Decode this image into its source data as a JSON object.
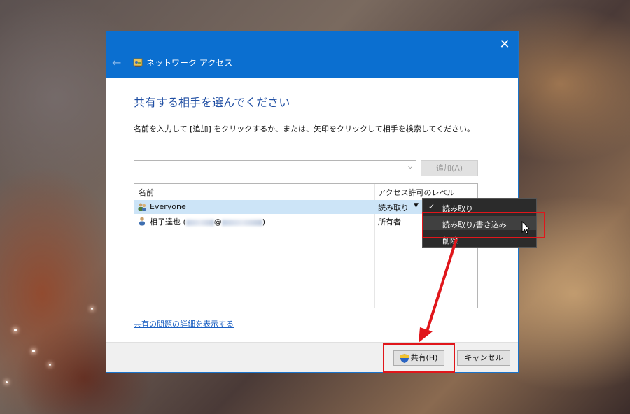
{
  "window": {
    "title": "ネットワーク アクセス",
    "close_glyph": "✕",
    "back_glyph": "←"
  },
  "heading": "共有する相手を選んでください",
  "instruction": "名前を入力して [追加] をクリックするか、または、矢印をクリックして相手を検索してください。",
  "input": {
    "value": "",
    "dropdown_glyph": "⌵"
  },
  "add_button": "追加(A)",
  "list": {
    "columns": [
      "名前",
      "アクセス許可のレベル"
    ],
    "rows": [
      {
        "name": "Everyone",
        "level": "読み取り",
        "arrow": "▼",
        "selected": true,
        "icon": "group-icon"
      },
      {
        "name_prefix": "相子達也 (",
        "name_at": "@",
        "name_suffix": ")",
        "level": "所有者",
        "selected": false,
        "icon": "user-icon"
      }
    ]
  },
  "link": "共有の問題の詳細を表示する",
  "footer": {
    "share_button": "共有(H)",
    "cancel_button": "キャンセル"
  },
  "context_menu": {
    "items": [
      {
        "label": "読み取り",
        "checked": true,
        "check_glyph": "✓"
      },
      {
        "label": "読み取り/書き込み",
        "checked": false
      },
      {
        "label": "削除",
        "checked": false
      }
    ]
  },
  "colors": {
    "titlebar": "#0b6fd0",
    "heading": "#1f4ea3",
    "link": "#1a5fc2",
    "annotation_red": "#e0161b",
    "selection": "#cce4f7"
  }
}
